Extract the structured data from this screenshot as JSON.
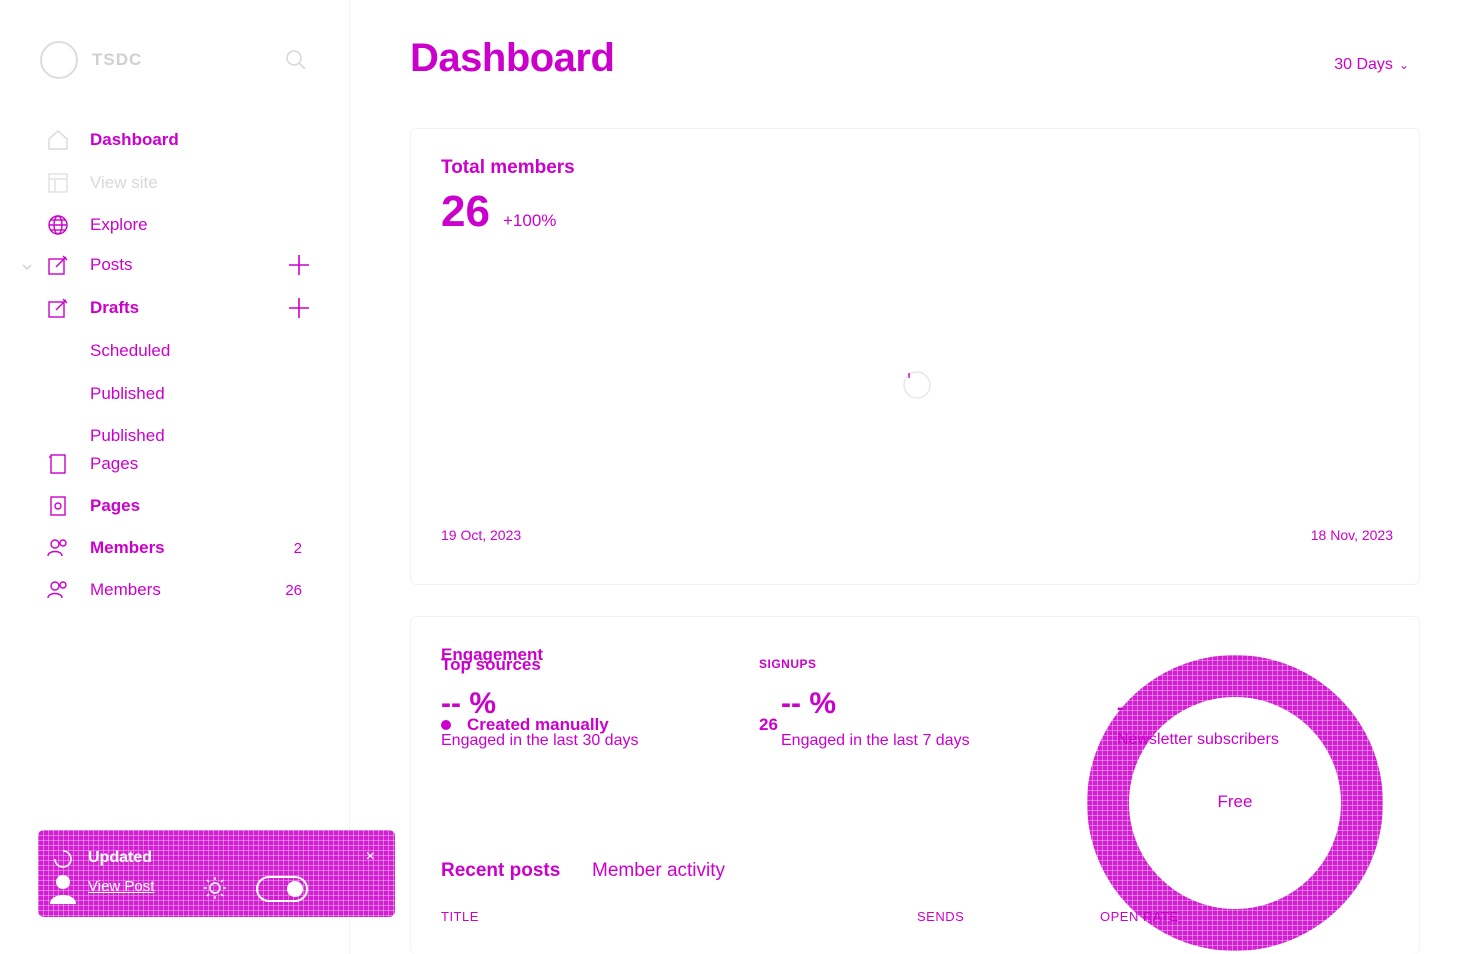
{
  "sidebar": {
    "brand": "TSDC",
    "items": [
      {
        "label": "Dashboard"
      },
      {
        "label": "View site"
      },
      {
        "label": "Explore"
      },
      {
        "label": "Posts"
      },
      {
        "label": "Drafts"
      },
      {
        "label": "Scheduled"
      },
      {
        "label": "Published"
      },
      {
        "label": "Published"
      },
      {
        "label": "Pages"
      },
      {
        "label": "Pages"
      },
      {
        "label": "Members",
        "count": "2"
      },
      {
        "label": "Members",
        "count": "26"
      }
    ]
  },
  "toast": {
    "title": "Updated",
    "link": "View Post",
    "close": "×"
  },
  "header": {
    "title": "Dashboard",
    "range": "30 Days"
  },
  "members_card": {
    "title": "Total members",
    "value": "26",
    "delta": "+100%",
    "start_date": "19 Oct, 2023",
    "end_date": "18 Nov, 2023"
  },
  "engagement_card": {
    "title": "Engagement",
    "sources_title": "Top sources",
    "signups_head": "SIGNUPS",
    "metric_30": {
      "value": "-- %",
      "caption": "Engaged in the last 30 days"
    },
    "metric_7": {
      "value": "-- %",
      "caption": "Engaged in the last 7 days"
    },
    "newsletter": {
      "value": "-",
      "caption": "Newsletter subscribers"
    },
    "source_row": {
      "name": "Created manually",
      "value": "26"
    },
    "donut_label": "Free",
    "tabs": [
      "Recent posts",
      "Member activity"
    ],
    "columns": [
      "TITLE",
      "SENDS",
      "OPEN RATE"
    ]
  },
  "colors": {
    "accent": "#cc00cc",
    "muted": "#d0d0d0"
  }
}
